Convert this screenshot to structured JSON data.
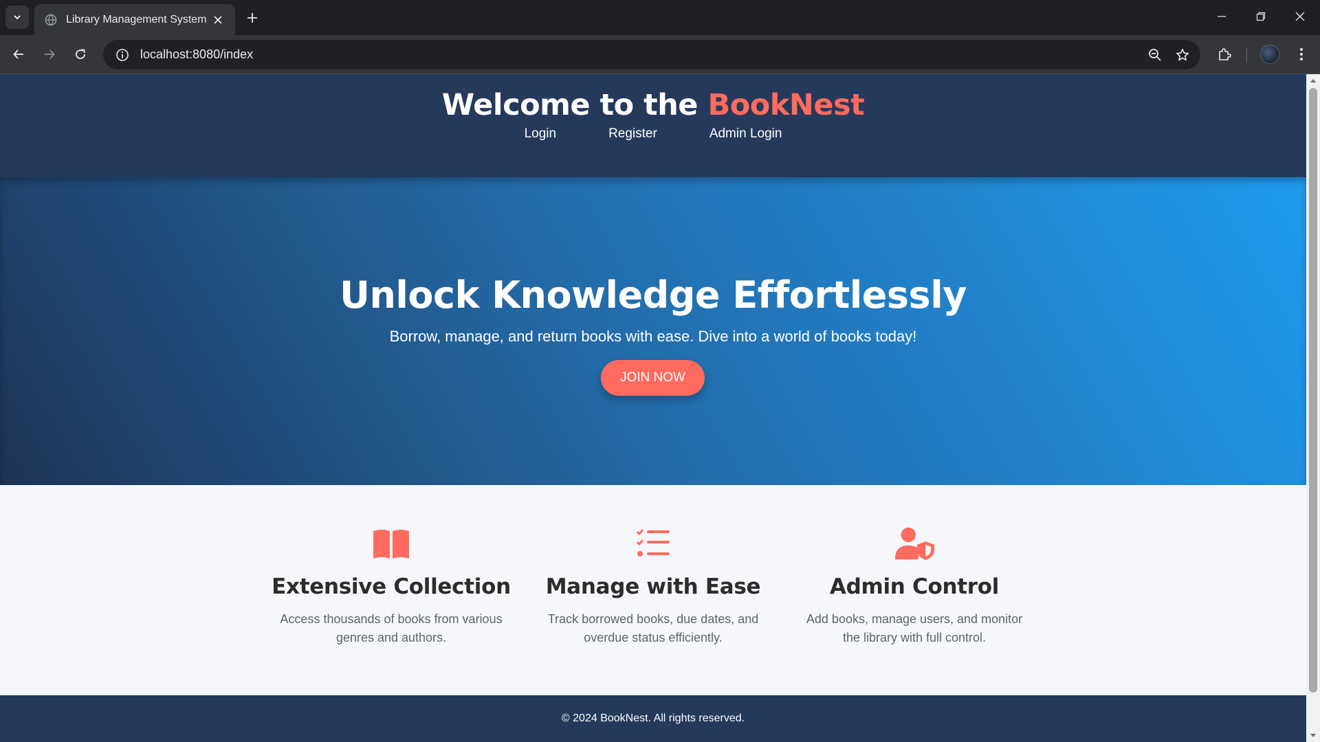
{
  "browser": {
    "tab_title": "Library Management System",
    "url": "localhost:8080/index"
  },
  "page": {
    "header": {
      "title_prefix": "Welcome to the ",
      "brand": "BookNest",
      "nav": [
        "Login",
        "Register",
        "Admin Login"
      ]
    },
    "hero": {
      "heading": "Unlock Knowledge Effortlessly",
      "subtext": "Borrow, manage, and return books with ease. Dive into a world of books today!",
      "cta": "JOIN NOW"
    },
    "features": [
      {
        "icon": "book-open-icon",
        "title": "Extensive Collection",
        "text": "Access thousands of books from various genres and authors."
      },
      {
        "icon": "task-list-icon",
        "title": "Manage with Ease",
        "text": "Track borrowed books, due dates, and overdue status efficiently."
      },
      {
        "icon": "user-shield-icon",
        "title": "Admin Control",
        "text": "Add books, manage users, and monitor the library with full control."
      }
    ],
    "footer": "© 2024 BookNest. All rights reserved."
  },
  "colors": {
    "accent": "#ff6b5e",
    "header_bg": "#25395b",
    "hero_gradient_start": "#1e3455",
    "hero_gradient_end": "#1f9bef"
  }
}
